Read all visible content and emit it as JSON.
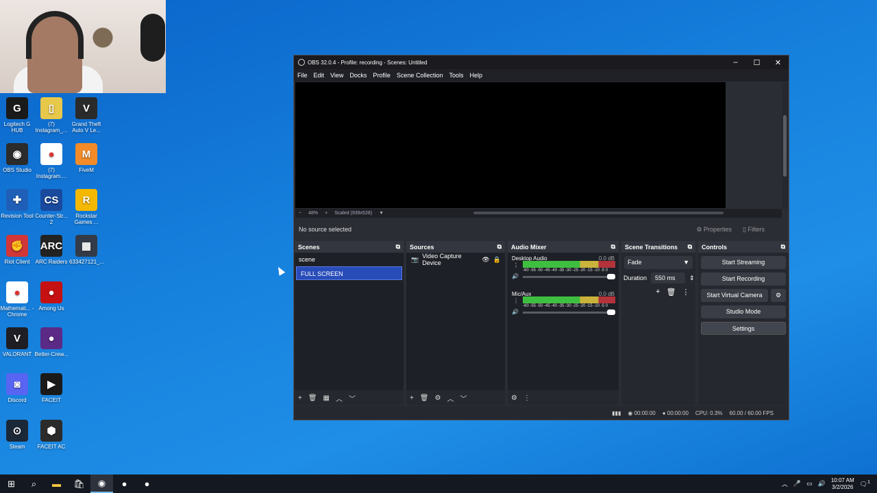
{
  "desktop": {
    "icons": [
      {
        "label": "Logitech G HUB",
        "color": "#1a1a1a",
        "glyph": "G"
      },
      {
        "label": "(7) Instagram_...",
        "color": "#e8c84a",
        "glyph": "▯"
      },
      {
        "label": "Grand Theft Auto V Le...",
        "color": "#2a2a2a",
        "glyph": "V"
      },
      {
        "label": "OBS Studio",
        "color": "#2b2b2b",
        "glyph": "◉"
      },
      {
        "label": "(7) Instagram....",
        "color": "#ffffff",
        "glyph": "●"
      },
      {
        "label": "FiveM",
        "color": "#f28b28",
        "glyph": "M"
      },
      {
        "label": "Revision Tool",
        "color": "#1f5fb8",
        "glyph": "✚"
      },
      {
        "label": "Counter-Str... 2",
        "color": "#1a4a9e",
        "glyph": "CS"
      },
      {
        "label": "Rockstar Games ...",
        "color": "#f5b800",
        "glyph": "R"
      },
      {
        "label": "Riot Client",
        "color": "#d13639",
        "glyph": "✊"
      },
      {
        "label": "ARC Raiders",
        "color": "#222222",
        "glyph": "ARC"
      },
      {
        "label": "633427121_...",
        "color": "#333b48",
        "glyph": "▦"
      },
      {
        "label": "Mathemati... - Chrome",
        "color": "#ffffff",
        "glyph": "●"
      },
      {
        "label": "Among Us",
        "color": "#c51111",
        "glyph": "●"
      },
      {
        "label": "VALORANT",
        "color": "#1e1e24",
        "glyph": "V"
      },
      {
        "label": "Better-Crew...",
        "color": "#5b2a86",
        "glyph": "●"
      },
      {
        "label": "Discord",
        "color": "#5865f2",
        "glyph": "◙"
      },
      {
        "label": "FACEIT",
        "color": "#1a1a1a",
        "glyph": "▶"
      },
      {
        "label": "Steam",
        "color": "#1b2838",
        "glyph": "⊙"
      },
      {
        "label": "FACEIT AC",
        "color": "#2b2b2b",
        "glyph": "⬢"
      }
    ]
  },
  "obs": {
    "title": "OBS 32.0.4 - Profile: recording - Scenes: Untitled",
    "menu": [
      "File",
      "Edit",
      "View",
      "Docks",
      "Profile",
      "Scene Collection",
      "Tools",
      "Help"
    ],
    "zoom": {
      "minus": "−",
      "level": "48%",
      "plus": "+",
      "scaled": "Scaled (939x528)"
    },
    "source_bar": {
      "status": "No source selected",
      "properties": "Properties",
      "filters": "Filters"
    },
    "scenes": {
      "title": "Scenes",
      "items": [
        "scene",
        "FULL SCREEN"
      ],
      "selected": "FULL SCREEN"
    },
    "sources": {
      "title": "Sources",
      "items": [
        "Video Capture Device"
      ]
    },
    "mixer": {
      "title": "Audio Mixer",
      "scale": "-60 -55 -50 -45 -40 -35 -30 -25 -20 -15 -10 -5 0",
      "channels": [
        {
          "name": "Desktop Audio",
          "level": "0.0 dB"
        },
        {
          "name": "Mic/Aux",
          "level": "0.0 dB"
        }
      ]
    },
    "transitions": {
      "title": "Scene Transitions",
      "type": "Fade",
      "duration_label": "Duration",
      "duration": "550 ms"
    },
    "controls": {
      "title": "Controls",
      "start_streaming": "Start Streaming",
      "start_recording": "Start Recording",
      "start_virtual_camera": "Start Virtual Camera",
      "studio_mode": "Studio Mode",
      "settings": "Settings"
    },
    "status": {
      "rec_time": "00:00:00",
      "stream_time": "00:00:00",
      "cpu": "CPU: 0.3%",
      "fps": "60.00 / 60.00 FPS"
    }
  },
  "taskbar": {
    "time": "10:07 AM",
    "date": "3/2/2026",
    "notifications": "1"
  }
}
